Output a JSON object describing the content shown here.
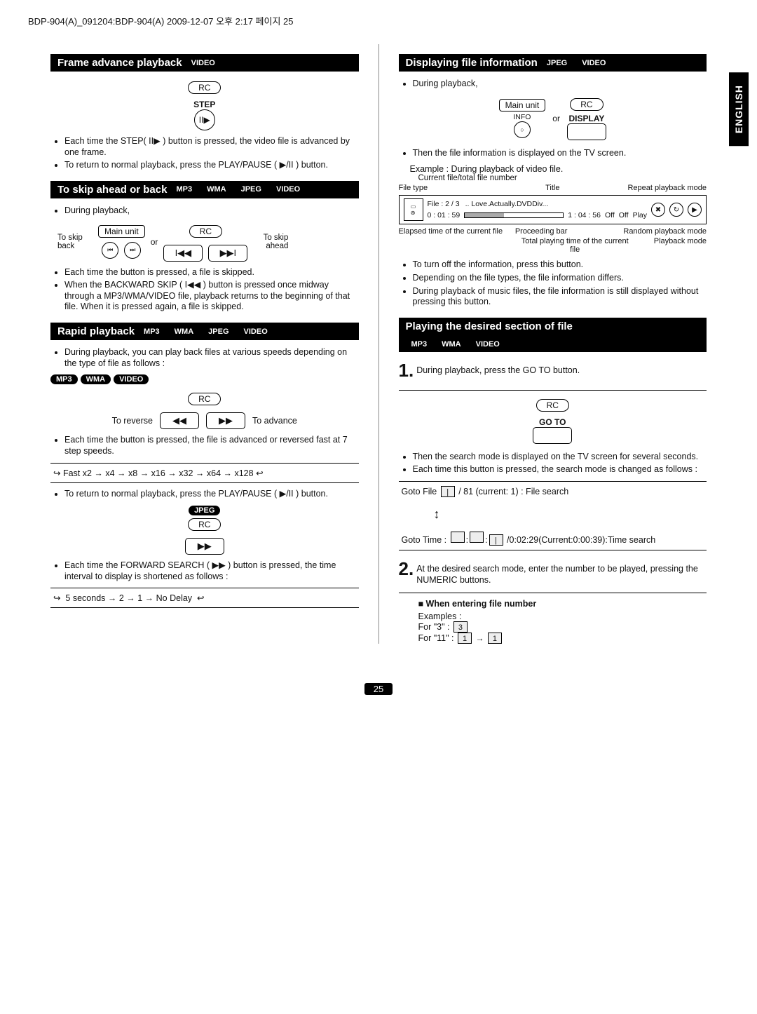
{
  "header": "BDP-904(A)_091204:BDP-904(A)  2009-12-07  오후 2:17  페이지 25",
  "side_tab": "ENGLISH",
  "page_number": "25",
  "pills": {
    "video": "VIDEO",
    "mp3": "MP3",
    "wma": "WMA",
    "jpeg": "JPEG"
  },
  "common": {
    "rc": "RC",
    "main_unit": "Main unit",
    "or": "or"
  },
  "left": {
    "sec1": {
      "title": "Frame advance playback",
      "step_label": "STEP",
      "step_icon": "II▶",
      "b1": "Each time the STEP( II▶ ) button is pressed, the video file is advanced by one frame.",
      "b2": "To return to normal playback, press the PLAY/PAUSE ( ▶/II ) button."
    },
    "sec2": {
      "title": "To skip ahead or back",
      "b0": "During playback,",
      "to_skip_back": "To skip back",
      "to_skip_ahead": "To skip ahead",
      "icon_back": "I◀◀",
      "icon_fwd": "▶▶I",
      "b1": "Each time the button is pressed, a file is skipped.",
      "b2": "When the BACKWARD SKIP ( I◀◀ ) button is pressed once midway through a MP3/WMA/VIDEO file, playback returns to the beginning of that file. When it is pressed again, a file is skipped."
    },
    "sec3": {
      "title": "Rapid playback",
      "b0": "During playback, you can play back files at various speeds depending on the type of file as follows :",
      "to_reverse": "To reverse",
      "to_advance": "To advance",
      "rev_icon": "◀◀",
      "adv_icon": "▶▶",
      "b1": "Each time the button is pressed, the file is advanced or reversed fast at 7 step speeds.",
      "speed": "Fast x2 → x4 → x8 → x16 → x32 → x64 → x128",
      "b2": "To return to normal playback, press the PLAY/PAUSE ( ▶/II ) button.",
      "jpeg_icon": "▶▶",
      "b3": "Each time the FORWARD SEARCH ( ▶▶ ) button is pressed, the time interval to display is shortened as follows :",
      "speed2": "5 seconds  →  2  →  1  →  No Delay"
    }
  },
  "right": {
    "sec1": {
      "title": "Displaying file information",
      "b0": "During playback,",
      "info_label": "INFO",
      "display_label": "DISPLAY",
      "b1": "Then the file information is displayed on the TV screen.",
      "example": "Example : During playback of video file.",
      "cap_current": "Current file/total file number",
      "cap_filetype": "File type",
      "cap_title": "Title",
      "cap_repeat": "Repeat playback mode",
      "file_num": "File : 2 / 3",
      "title_text": ".. Love.Actually.DVDDiv...",
      "elapsed": "0 : 01 : 59",
      "total": "1 : 04 : 56",
      "off1": "Off",
      "off2": "Off",
      "play": "Play",
      "lbl_elapsed": "Elapsed time of the current file",
      "lbl_proceeding": "Proceeding bar",
      "lbl_random": "Random playback mode",
      "lbl_total": "Total playing time of the current file",
      "lbl_playmode": "Playback mode",
      "b2": "To turn off the information, press this button.",
      "b3": "Depending on the file types, the file information differs.",
      "b4": "During playback of music files, the file information is still displayed without pressing this button."
    },
    "sec2": {
      "title": "Playing the desired section of file",
      "step1": "During playback, press the GO TO button.",
      "goto_label": "GO TO",
      "b1": "Then the search mode is displayed on the TV screen for several seconds.",
      "b2": "Each time this button is pressed, the search mode is changed as follows :",
      "goto_file": "Goto File",
      "file_rest": "/ 81 (current: 1)    : File search",
      "updown": "↕",
      "goto_time": "Goto Time :",
      "time_rest": "/0:02:29(Current:0:00:39):Time search",
      "step2": "At the desired search mode, enter the number to be played, pressing the NUMERIC buttons.",
      "when_entering": "When entering file number",
      "examples": "Examples :",
      "for3": "For \"3\" :",
      "for11": "For \"11\" :",
      "n3": "3",
      "n1a": "1",
      "n1b": "1"
    }
  }
}
